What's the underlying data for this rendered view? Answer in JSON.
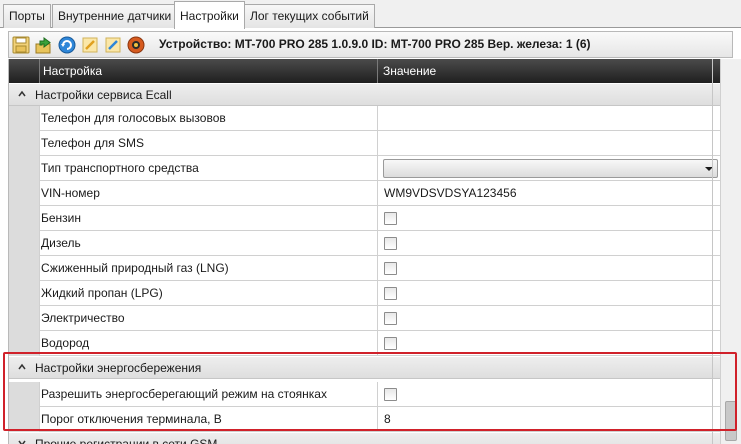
{
  "tabs": [
    {
      "label": "Порты",
      "active": false
    },
    {
      "label": "Внутренние датчики",
      "active": false
    },
    {
      "label": "Настройки",
      "active": true
    },
    {
      "label": "Лог текущих событий",
      "active": false
    }
  ],
  "toolbar": {
    "device_info": "Устройство: MT-700 PRO 285 1.0.9.0 ID: MT-700 PRO 285 Вер. железа: 1 (6)",
    "buttons": [
      "save-icon",
      "upload-icon",
      "reload-icon",
      "edit-icon",
      "edit-pencil-icon",
      "reset-icon"
    ]
  },
  "grid": {
    "headers": {
      "setting": "Настройка",
      "value": "Значение"
    },
    "groups": [
      {
        "label": "Настройки сервиса Ecall",
        "expanded": true
      },
      {
        "label": "Настройки энергосбережения",
        "expanded": true
      },
      {
        "label": "Прочие регистрации в сети GSM",
        "expanded": false
      }
    ],
    "rows": [
      {
        "name": "Телефон для голосовых вызовов",
        "kind": "text",
        "value": ""
      },
      {
        "name": "Телефон для SMS",
        "kind": "text",
        "value": ""
      },
      {
        "name": "Тип транспортного средства",
        "kind": "select",
        "value": ""
      },
      {
        "name": "VIN-номер",
        "kind": "text",
        "value": "WM9VDSVDSYA123456"
      },
      {
        "name": "Бензин",
        "kind": "checkbox",
        "checked": false
      },
      {
        "name": "Дизель",
        "kind": "checkbox",
        "checked": false
      },
      {
        "name": "Сжиженный природный газ (LNG)",
        "kind": "checkbox",
        "checked": false
      },
      {
        "name": "Жидкий пропан (LPG)",
        "kind": "checkbox",
        "checked": false
      },
      {
        "name": "Электричество",
        "kind": "checkbox",
        "checked": false
      },
      {
        "name": "Водород",
        "kind": "checkbox",
        "checked": false
      },
      {
        "name": "Разрешить энергосберегающий режим на стоянках",
        "kind": "checkbox",
        "checked": false
      },
      {
        "name": "Порог отключения терминала, В",
        "kind": "text",
        "value": "8"
      }
    ]
  },
  "colors": {
    "highlight": "#d0212a",
    "header_bg": "#2b2b2b"
  }
}
